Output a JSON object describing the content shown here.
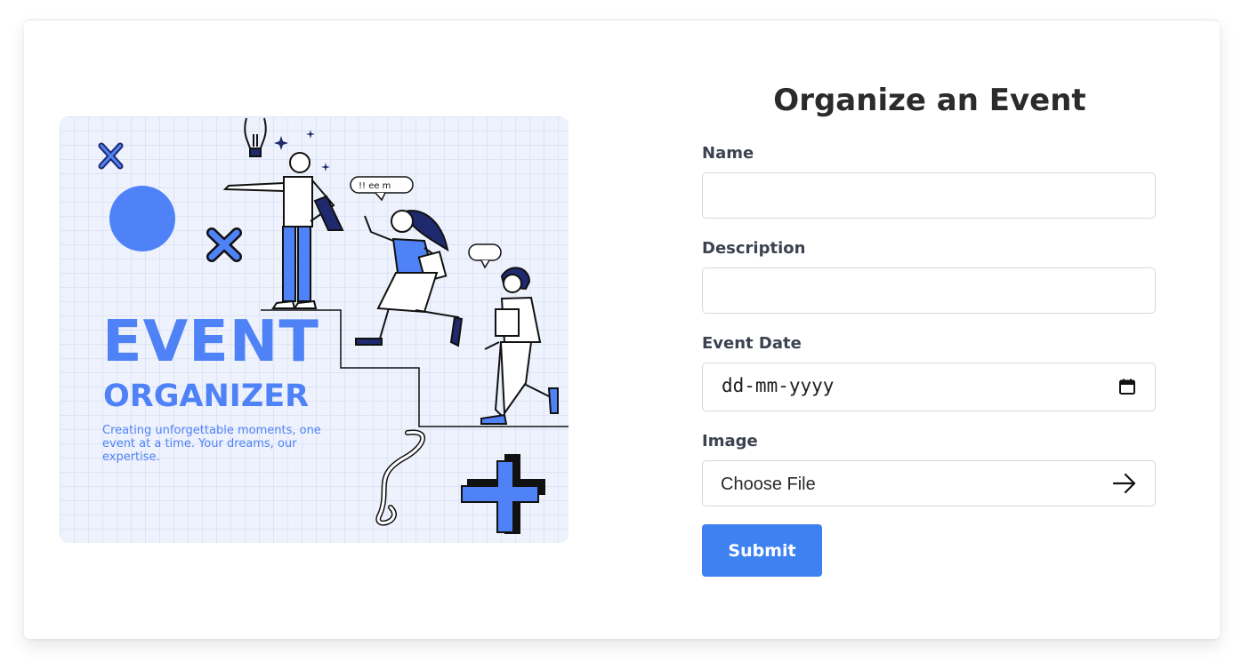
{
  "illustration": {
    "title": "EVENT",
    "subtitle": "ORGANIZER",
    "tagline": "Creating unforgettable moments, one event at a time. Your dreams, our expertise.",
    "speech_bubble": "!! ee m"
  },
  "form": {
    "title": "Organize an Event",
    "fields": {
      "name": {
        "label": "Name",
        "value": ""
      },
      "description": {
        "label": "Description",
        "value": ""
      },
      "event_date": {
        "label": "Event Date",
        "placeholder": "dd-mm-yyyy",
        "icon": "calendar-icon"
      },
      "image": {
        "label": "Image",
        "button_text": "Choose File",
        "icon": "arrow-right-icon"
      }
    },
    "submit_label": "Submit"
  },
  "colors": {
    "accent": "#3e82f2",
    "illustration_blue": "#4f82f7",
    "navy": "#1f2a6e",
    "heading": "#2b2b2b",
    "label": "#3c4250"
  }
}
